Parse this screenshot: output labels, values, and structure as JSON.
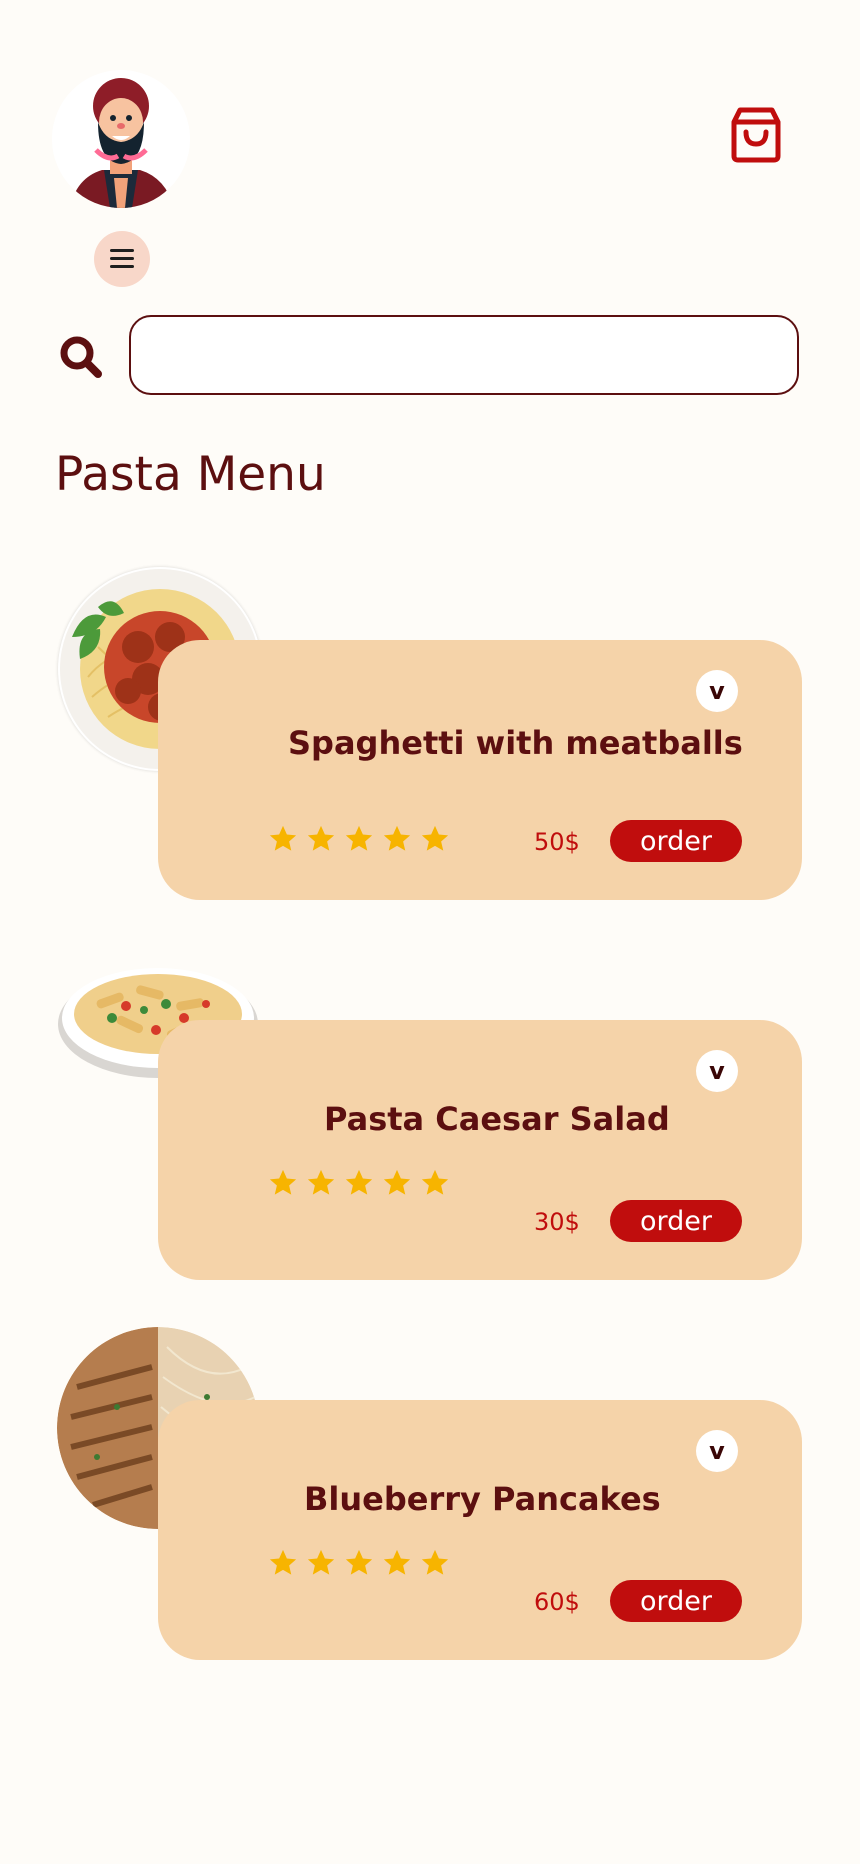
{
  "header": {
    "avatar_icon": "bearded-man-avatar",
    "cart_icon": "shopping-bag-icon",
    "menu_icon": "hamburger-menu-icon"
  },
  "search": {
    "icon": "search-icon",
    "value": "",
    "placeholder": ""
  },
  "main": {
    "title": "Pasta Menu",
    "items": [
      {
        "name": "Spaghetti with meatballs",
        "rating": 5,
        "price": "50$",
        "order_label": "order",
        "expand_glyph": "v",
        "image": "spaghetti-meatballs-plate"
      },
      {
        "name": "Pasta Caesar Salad",
        "rating": 5,
        "price": "30$",
        "order_label": "order",
        "expand_glyph": "v",
        "image": "penne-salad-plate"
      },
      {
        "name": "Blueberry Pancakes",
        "rating": 5,
        "price": "60$",
        "order_label": "order",
        "expand_glyph": "v",
        "image": "grilled-chicken-pasta-plate"
      }
    ]
  },
  "colors": {
    "background": "#fefcf8",
    "card": "#f5d3a9",
    "brand_dark": "#5c0f10",
    "accent_red": "#c00d0d",
    "star": "#f7b400",
    "menu_button": "#f8d7c9"
  }
}
